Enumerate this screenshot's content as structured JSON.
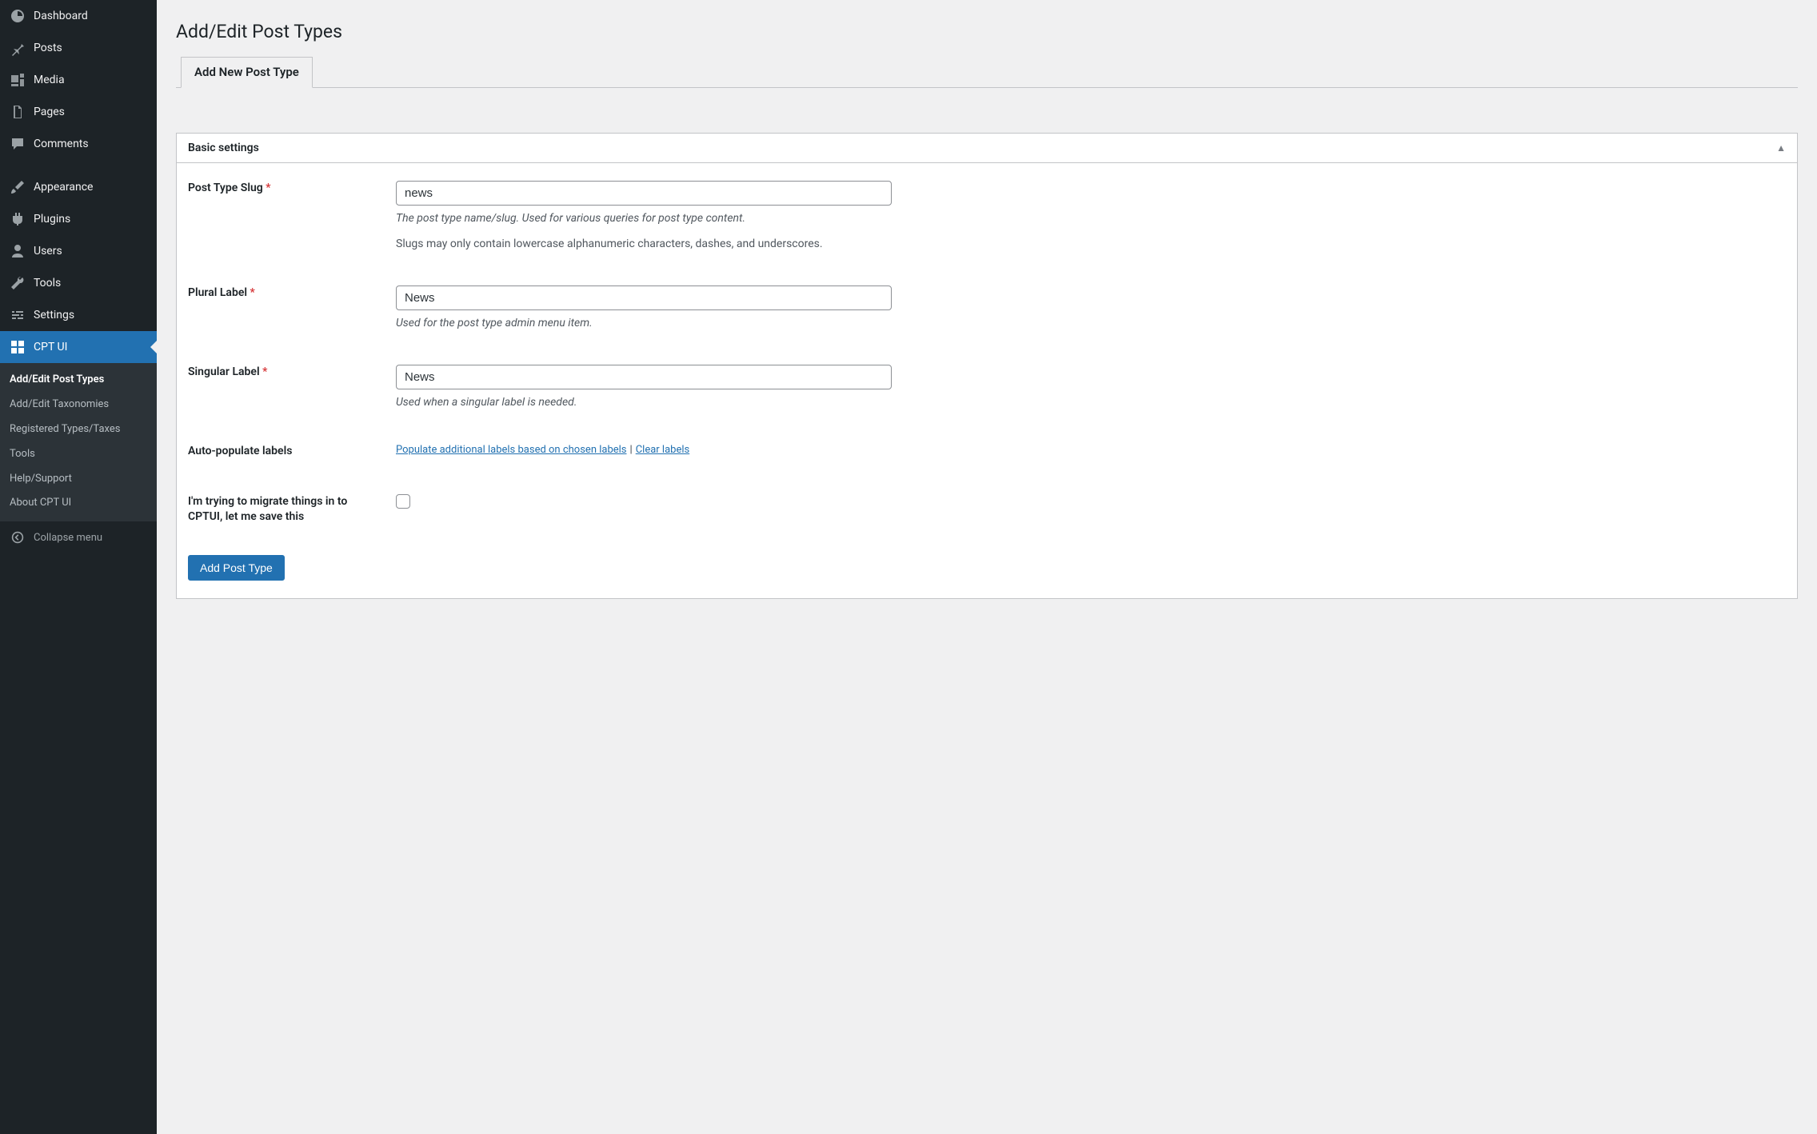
{
  "sidebar": {
    "items": [
      {
        "label": "Dashboard",
        "icon": "dashboard"
      },
      {
        "label": "Posts",
        "icon": "pin"
      },
      {
        "label": "Media",
        "icon": "media"
      },
      {
        "label": "Pages",
        "icon": "pages"
      },
      {
        "label": "Comments",
        "icon": "comments"
      },
      {
        "label": "Appearance",
        "icon": "brush"
      },
      {
        "label": "Plugins",
        "icon": "plugin"
      },
      {
        "label": "Users",
        "icon": "user"
      },
      {
        "label": "Tools",
        "icon": "wrench"
      },
      {
        "label": "Settings",
        "icon": "sliders"
      },
      {
        "label": "CPT UI",
        "icon": "grid",
        "active": true
      }
    ],
    "submenu": [
      {
        "label": "Add/Edit Post Types",
        "current": true
      },
      {
        "label": "Add/Edit Taxonomies"
      },
      {
        "label": "Registered Types/Taxes"
      },
      {
        "label": "Tools"
      },
      {
        "label": "Help/Support"
      },
      {
        "label": "About CPT UI"
      }
    ],
    "collapse_label": "Collapse menu"
  },
  "page": {
    "title": "Add/Edit Post Types",
    "tab_label": "Add New Post Type",
    "box_title": "Basic settings"
  },
  "fields": {
    "slug": {
      "label": "Post Type Slug",
      "value": "news",
      "desc1": "The post type name/slug. Used for various queries for post type content.",
      "desc2": "Slugs may only contain lowercase alphanumeric characters, dashes, and underscores."
    },
    "plural": {
      "label": "Plural Label",
      "value": "News",
      "desc": "Used for the post type admin menu item."
    },
    "singular": {
      "label": "Singular Label",
      "value": "News",
      "desc": "Used when a singular label is needed."
    },
    "auto": {
      "label": "Auto-populate labels",
      "populate_link": "Populate additional labels based on chosen labels",
      "clear_link": "Clear labels"
    },
    "migrate": {
      "label": "I'm trying to migrate things in to CPTUI, let me save this"
    }
  },
  "submit_label": "Add Post Type"
}
